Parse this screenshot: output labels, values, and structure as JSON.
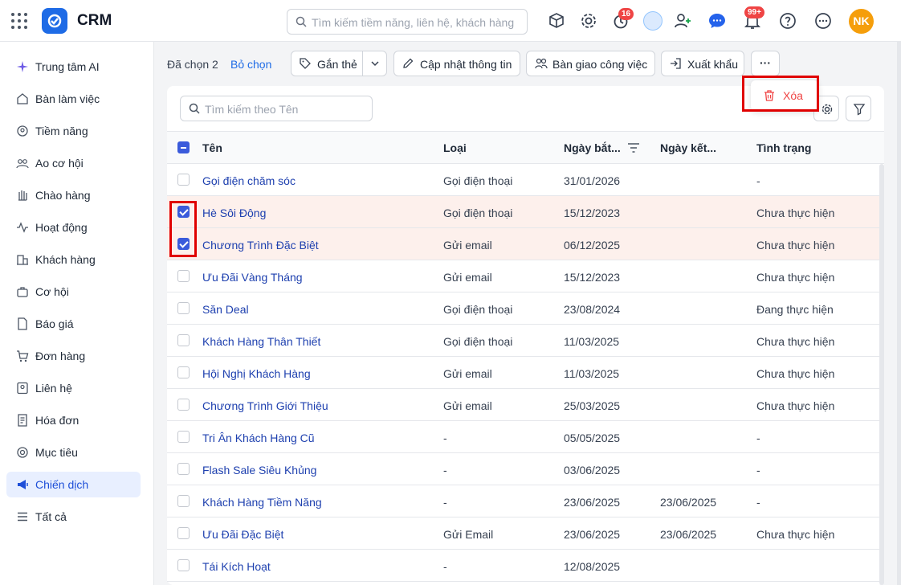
{
  "app": {
    "title": "CRM"
  },
  "top_search": {
    "placeholder": "Tìm kiếm tiềm năng, liên hệ, khách hàng"
  },
  "header_icons": {
    "reminder_badge": "16",
    "notification_badge": "99+",
    "user_initials": "NK"
  },
  "sidebar": {
    "items": [
      {
        "label": "Trung tâm AI",
        "icon": "sparkle-icon"
      },
      {
        "label": "Bàn làm việc",
        "icon": "home-icon"
      },
      {
        "label": "Tiềm năng",
        "icon": "target-user-icon"
      },
      {
        "label": "Ao cơ hội",
        "icon": "users-group-icon"
      },
      {
        "label": "Chào hàng",
        "icon": "hand-icon"
      },
      {
        "label": "Hoạt động",
        "icon": "activity-icon"
      },
      {
        "label": "Khách hàng",
        "icon": "building-icon"
      },
      {
        "label": "Cơ hội",
        "icon": "briefcase-icon"
      },
      {
        "label": "Báo giá",
        "icon": "quote-doc-icon"
      },
      {
        "label": "Đơn hàng",
        "icon": "cart-icon"
      },
      {
        "label": "Liên hệ",
        "icon": "contact-card-icon"
      },
      {
        "label": "Hóa đơn",
        "icon": "invoice-icon"
      },
      {
        "label": "Mục tiêu",
        "icon": "goal-icon"
      },
      {
        "label": "Chiến dịch",
        "icon": "megaphone-icon",
        "active": true
      },
      {
        "label": "Tất cả",
        "icon": "menu-icon"
      }
    ]
  },
  "action_bar": {
    "selected_label": "Đã chọn 2",
    "unselect_label": "Bỏ chọn",
    "tag_label": "Gắn thẻ",
    "update_label": "Cập nhật thông tin",
    "handover_label": "Bàn giao công việc",
    "export_label": "Xuất khẩu",
    "more_label": "···"
  },
  "more_menu": {
    "delete_label": "Xóa"
  },
  "list": {
    "search_placeholder": "Tìm kiếm theo Tên",
    "columns": {
      "name": "Tên",
      "type": "Loại",
      "start": "Ngày bắt...",
      "end": "Ngày kết...",
      "status": "Tình trạng"
    },
    "rows": [
      {
        "name": "Gọi điện chăm sóc",
        "type": "Gọi điện thoại",
        "start": "31/01/2026",
        "end": "",
        "status": "-",
        "selected": false
      },
      {
        "name": "Hè Sôi Động",
        "type": "Gọi điện thoại",
        "start": "15/12/2023",
        "end": "",
        "status": "Chưa thực hiện",
        "selected": true
      },
      {
        "name": "Chương Trình Đặc Biệt",
        "type": "Gửi email",
        "start": "06/12/2025",
        "end": "",
        "status": "Chưa thực hiện",
        "selected": true
      },
      {
        "name": "Ưu Đãi Vàng Tháng",
        "type": "Gửi email",
        "start": "15/12/2023",
        "end": "",
        "status": "Chưa thực hiện",
        "selected": false
      },
      {
        "name": "Săn Deal",
        "type": "Gọi điện thoại",
        "start": "23/08/2024",
        "end": "",
        "status": "Đang thực hiện",
        "selected": false
      },
      {
        "name": "Khách Hàng Thân Thiết",
        "type": "Gọi điện thoại",
        "start": "11/03/2025",
        "end": "",
        "status": "Chưa thực hiện",
        "selected": false
      },
      {
        "name": "Hội Nghị Khách Hàng",
        "type": "Gửi email",
        "start": "11/03/2025",
        "end": "",
        "status": "Chưa thực hiện",
        "selected": false
      },
      {
        "name": "Chương Trình Giới Thiệu",
        "type": "Gửi email",
        "start": "25/03/2025",
        "end": "",
        "status": "Chưa thực hiện",
        "selected": false
      },
      {
        "name": "Tri Ân Khách Hàng Cũ",
        "type": "-",
        "start": "05/05/2025",
        "end": "",
        "status": "-",
        "selected": false
      },
      {
        "name": "Flash Sale Siêu Khủng",
        "type": "-",
        "start": "03/06/2025",
        "end": "",
        "status": "-",
        "selected": false
      },
      {
        "name": "Khách Hàng Tiềm Năng",
        "type": "-",
        "start": "23/06/2025",
        "end": "23/06/2025",
        "status": "-",
        "selected": false
      },
      {
        "name": "Ưu Đãi Đặc Biệt",
        "type": "Gửi Email",
        "start": "23/06/2025",
        "end": "23/06/2025",
        "status": "Chưa thực hiện",
        "selected": false
      },
      {
        "name": "Tái Kích Hoạt",
        "type": "-",
        "start": "12/08/2025",
        "end": "",
        "status": "",
        "selected": false
      }
    ]
  },
  "colors": {
    "accent": "#1e6be6",
    "selected_row": "#fdf0ec",
    "danger": "#ef4444",
    "highlight": "#e00000"
  }
}
